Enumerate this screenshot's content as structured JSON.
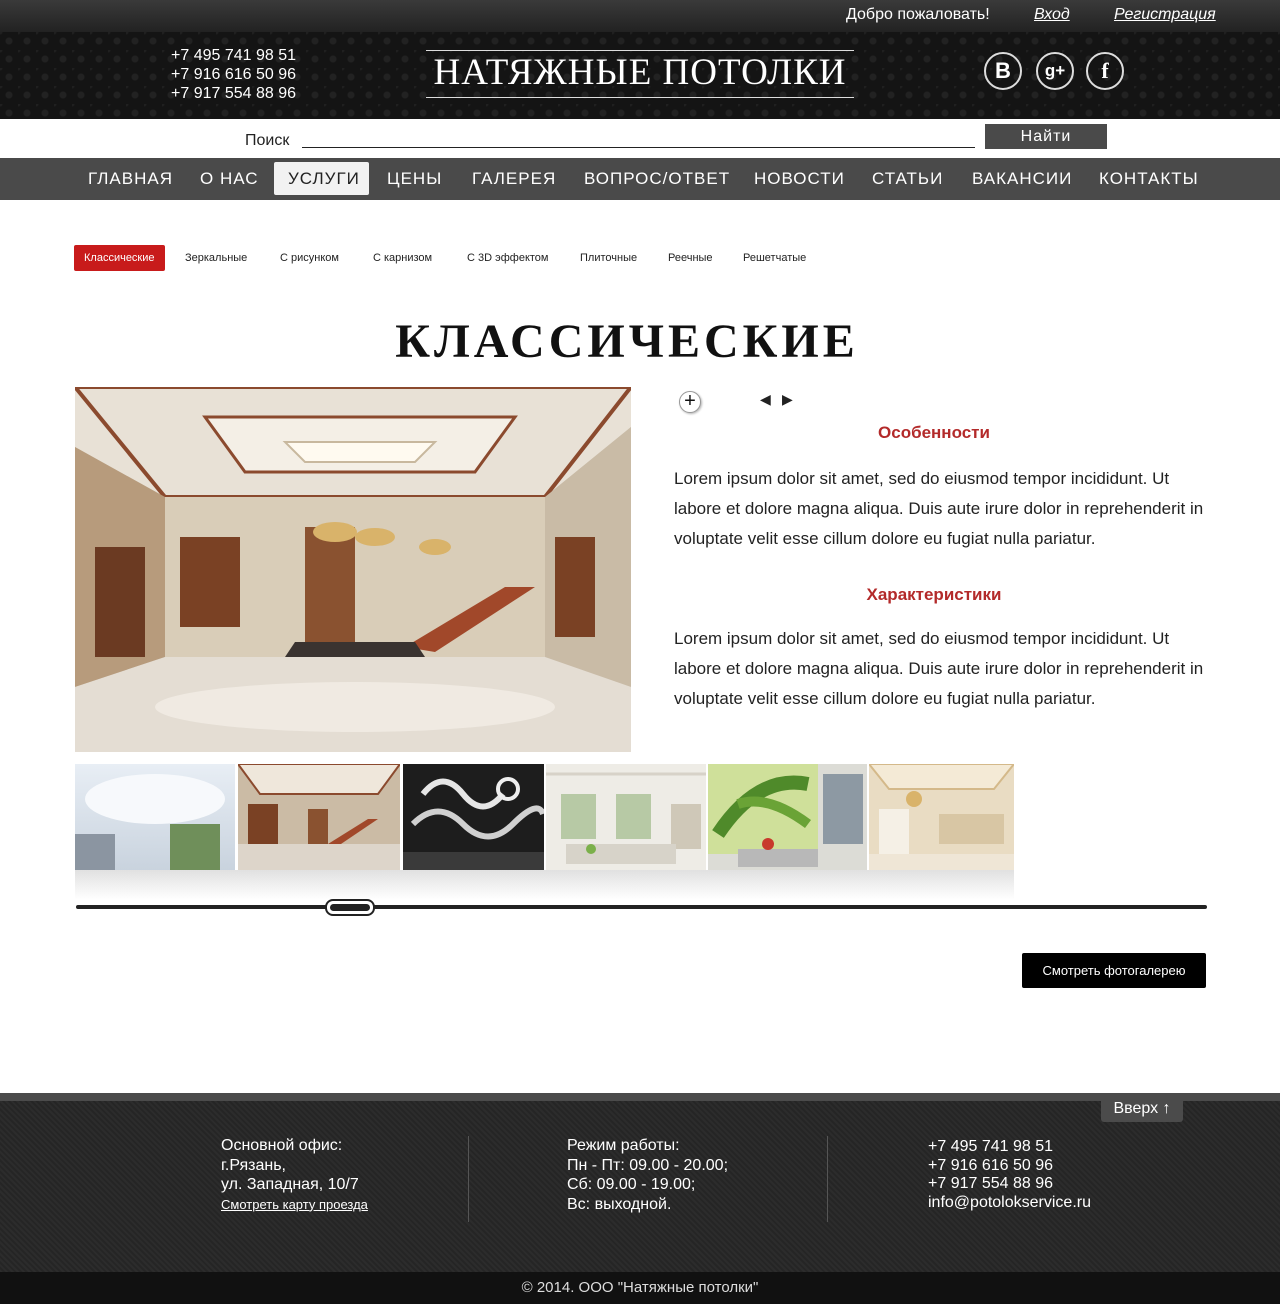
{
  "topbar": {
    "welcome": "Добро пожаловать!",
    "login": "Вход",
    "register": "Регистрация"
  },
  "header": {
    "phones": [
      "+7 495 741 98 51",
      "+7 916 616 50 96",
      "+7 917 554 88 96"
    ],
    "logo": "НАТЯЖНЫЕ ПОТОЛКИ",
    "social": [
      {
        "name": "vk-icon",
        "glyph": "B"
      },
      {
        "name": "google-plus-icon",
        "glyph": "g+"
      },
      {
        "name": "facebook-icon",
        "glyph": "f"
      }
    ]
  },
  "search": {
    "label": "Поиск",
    "value": "",
    "placeholder": "",
    "button": "Найти"
  },
  "nav": {
    "items": [
      "ГЛАВНАЯ",
      "О НАС",
      "УСЛУГИ",
      "ЦЕНЫ",
      "ГАЛЕРЕЯ",
      "ВОПРОС/ОТВЕТ",
      "НОВОСТИ",
      "СТАТЬИ",
      "ВАКАНСИИ",
      "КОНТАКТЫ"
    ],
    "active": "УСЛУГИ"
  },
  "subtabs": {
    "items": [
      "Классические",
      "Зеркальные",
      "С рисунком",
      "С карнизом",
      "С 3D эффектом",
      "Плиточные",
      "Реечные",
      "Решетчатые"
    ],
    "active": "Классические"
  },
  "main": {
    "title": "КЛАССИЧЕСКИЕ",
    "zoom_glyph": "+",
    "prev_glyph": "◀",
    "next_glyph": "▶",
    "features_heading": "Особенности",
    "features_text": "Lorem ipsum dolor sit amet,  sed do eiusmod tempor incididunt. Ut labore et dolore magna aliqua. Duis aute irure dolor in reprehenderit in voluptate velit esse cillum dolore eu fugiat nulla pariatur.",
    "specs_heading": "Характеристики",
    "specs_text": "Lorem ipsum dolor sit amet,  sed do eiusmod tempor incididunt. Ut labore et dolore magna aliqua. Duis aute irure dolor in reprehenderit in voluptate velit esse cillum dolore eu fugiat nulla pariatur.",
    "gallery_button": "Смотреть  фотогалерею"
  },
  "slider": {
    "position": 0.22
  },
  "footer": {
    "up_button": "Вверх ↑",
    "office": [
      "Основной офис:",
      "г.Рязань,",
      "ул. Западная, 10/7"
    ],
    "map_link": "Смотреть карту проезда",
    "hours": [
      "Режим работы:",
      "Пн - Пт: 09.00 - 20.00;",
      "Сб: 09.00 - 19.00;",
      "Вс: выходной."
    ],
    "contacts": [
      "+7 495 741 98 51",
      "+7 916 616 50 96",
      "+7 917 554 88 96",
      "info@potolokservice.ru"
    ],
    "copyright": "© 2014. ООО \"Натяжные потолки\""
  }
}
